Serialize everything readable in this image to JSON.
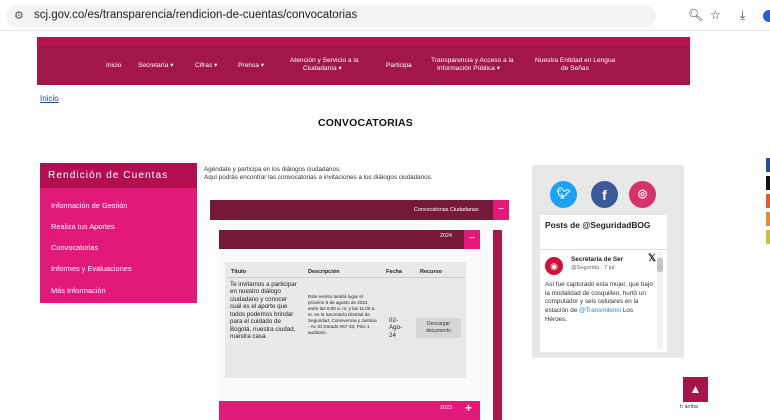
{
  "browser": {
    "url": "scj.gov.co/es/transparencia/rendicion-de-cuentas/convocatorias",
    "site_info_icon": "tune-icon",
    "zoom_icon": "zoom-icon",
    "star_icon": "star-icon",
    "download_icon": "download-icon"
  },
  "nav": {
    "items": [
      "Inicio",
      "Secretaría ▾",
      "Cifras ▾",
      "Prensa ▾",
      "Atención y Servicio a la",
      "Ciudadanía ▾",
      "Participa",
      "Transparencia y Acceso a la",
      "Información Pública ▾",
      "Nuestra Entidad en Lengua",
      "de Señas"
    ]
  },
  "breadcrumb": "Inicio",
  "page_title": "CONVOCATORIAS",
  "sidebar": {
    "title": "Rendición de Cuentas",
    "items": [
      "Información de Gestión",
      "Realiza tus Aportes",
      "Convocatorias",
      "Informes y Evaluaciones",
      "Más Información"
    ]
  },
  "intro": {
    "line1": "Agéndate y participa en los diálogos ciudadanos.",
    "line2": "Aquí podrás encontrar las convocatorias a invitaciones a los diálogos ciudadanos."
  },
  "convocatorias": {
    "header": "Convocatorias Ciudadanas",
    "minus": "−",
    "year_2024": "2024",
    "year_2023": "2023",
    "plus": "+",
    "table": {
      "headers": [
        "Título",
        "Descripción",
        "Fecha",
        "Recurso"
      ],
      "row": {
        "title": "Te invitamos a participar en nuestro diálogo ciudadano y conocer cuál es el aporte que todos podemos brindar para el cuidado de Bogotá, nuestra ciudad, nuestra casa.",
        "description": "Este evento tendrá lugar el próximo 9 de agosto de 2024, entre las 9:00 a. m. y las 11:00 a. m. en la Secretaría Distrital de Seguridad, Convivencia y Justicia - Av. El Dorado #67-33, Piso 1 auditorio.",
        "date": "02-Ago-24",
        "resource": "Descargar documento"
      }
    }
  },
  "social": {
    "twitter_icon": "twitter-icon",
    "facebook_icon": "facebook-icon",
    "instagram_icon": "instagram-icon",
    "posts_title": "Posts de @SeguridadBOG",
    "tweet": {
      "name": "Secretaría de Ser",
      "handle": "@Segurida · 7 jul.",
      "text": "Así fue capturado esta mujer, que bajo la modalidad de cosquilleo, hurtó un computador y seis celulares en la estación de",
      "mention": "@Transmilenio",
      "text_end": " Los Héroes."
    }
  },
  "scroll_top": {
    "label": "Ir arriba",
    "icon": "chevron-up-icon"
  },
  "colors": {
    "brand": "#a3164a",
    "accent": "#e3197a",
    "dark": "#76183a"
  }
}
